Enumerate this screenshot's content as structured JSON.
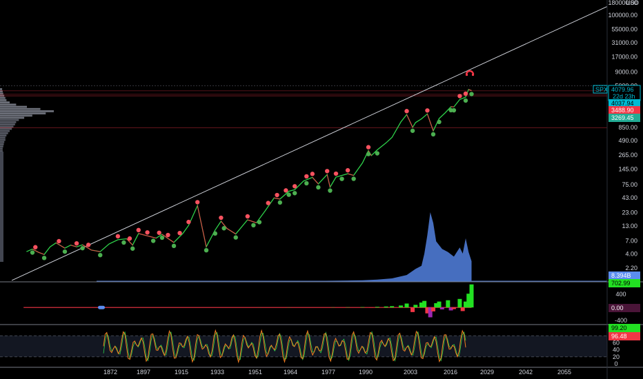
{
  "chart_data": [
    {
      "type": "line",
      "title": "",
      "symbol": "SPX",
      "currency": "USD",
      "scale": "log",
      "ylim": [
        1.5,
        180000
      ],
      "xlim": [
        1862,
        2068
      ],
      "y_ticks": [
        "180000.00",
        "100000.00",
        "55000.00",
        "31000.00",
        "17000.00",
        "9000.00",
        "5000.00",
        "2800.00",
        "1550.00",
        "850.00",
        "490.00",
        "265.00",
        "145.00",
        "75.00",
        "43.00",
        "23.00",
        "13.00",
        "7.00",
        "4.00",
        "2.20"
      ],
      "x_ticks": [
        "1872",
        "1897",
        "1915",
        "1933",
        "1951",
        "1964",
        "1977",
        "1990",
        "2003",
        "2016",
        "2029",
        "2042",
        "2055"
      ],
      "series": [
        {
          "name": "SPX",
          "color": "#2ed24a",
          "x": [
            1871,
            1873,
            1875,
            1877,
            1879,
            1881,
            1884,
            1886,
            1888,
            1890,
            1893,
            1896,
            1899,
            1902,
            1905,
            1907,
            1909,
            1912,
            1915,
            1917,
            1919,
            1921,
            1924,
            1926,
            1929,
            1932,
            1935,
            1937,
            1939,
            1942,
            1946,
            1949,
            1952,
            1955,
            1957,
            1960,
            1962,
            1965,
            1968,
            1970,
            1973,
            1974,
            1976,
            1980,
            1982,
            1985,
            1987,
            1988,
            1990,
            1993,
            1995,
            1998,
            2000,
            2002,
            2003,
            2005,
            2007,
            2009,
            2011,
            2013,
            2015,
            2016,
            2018,
            2020,
            2021,
            2022
          ],
          "y": [
            4.4,
            4.9,
            4.3,
            3.9,
            5.4,
            6.4,
            5.1,
            5.8,
            5.4,
            5.9,
            4.7,
            4.4,
            6.1,
            7.3,
            7.6,
            5.8,
            9.5,
            8.6,
            7.8,
            9.2,
            7.7,
            6.5,
            9.5,
            13.4,
            31,
            5.4,
            11,
            16,
            11.8,
            9.3,
            17,
            15,
            25,
            43,
            41,
            57,
            61,
            88,
            103,
            78,
            116,
            68,
            104,
            120,
            112,
            190,
            320,
            260,
            330,
            445,
            560,
            1080,
            1480,
            860,
            1050,
            1230,
            1520,
            740,
            1250,
            1580,
            2060,
            2050,
            2800,
            3100,
            4300,
            4079.96
          ]
        }
      ],
      "pivot_highs_x": [
        1874,
        1882,
        1888,
        1892,
        1902,
        1906,
        1909,
        1912,
        1916,
        1919,
        1923,
        1926,
        1929,
        1937,
        1946,
        1953,
        1956,
        1959,
        1962,
        1966,
        1968,
        1973,
        1976,
        1980,
        1987,
        2000,
        2007,
        2018,
        2020
      ],
      "pivot_lows_x": [
        1873,
        1877,
        1884,
        1890,
        1896,
        1904,
        1907,
        1914,
        1917,
        1921,
        1932,
        1935,
        1938,
        1942,
        1948,
        1950,
        1957,
        1960,
        1962,
        1966,
        1970,
        1974,
        1978,
        1982,
        1987,
        1990,
        2002,
        2009,
        2011,
        2015,
        2016,
        2020,
        2022
      ],
      "trendline": {
        "x": [
          1866,
          2068
        ],
        "y": [
          1.3,
          145000
        ]
      },
      "horizontal_levels": [
        4037.94,
        3488.9,
        3269.45,
        850,
        5000
      ],
      "price_tags": [
        {
          "label": "SPX",
          "value": "4079.96",
          "sub": "22d 23h",
          "color": "#00bcd4"
        },
        {
          "label": "",
          "value": "4037.94",
          "color": "#00bcd4"
        },
        {
          "label": "",
          "value": "3488.90",
          "color": "#f23645"
        },
        {
          "label": "",
          "value": "3269.45",
          "color": "#22ab94"
        }
      ],
      "volume_profile_bins": [
        0.04,
        0.05,
        0.06,
        0.08,
        0.1,
        0.12,
        0.18,
        0.3,
        0.5,
        0.75,
        1.0,
        0.85,
        0.6,
        0.45,
        0.35,
        0.3,
        0.28,
        0.25,
        0.22,
        0.18,
        0.15,
        0.12,
        0.1,
        0.1,
        0.08,
        0.07,
        0.06,
        0.05,
        0.05
      ]
    },
    {
      "type": "area",
      "title": "",
      "label": "Volume",
      "value_tag": "8.394B",
      "color": "#4a74c9",
      "x": [
        1950,
        1960,
        1970,
        1980,
        1985,
        1990,
        1995,
        2000,
        2003,
        2005,
        2006,
        2007,
        2008,
        2009,
        2010,
        2012,
        2014,
        2016,
        2018,
        2019,
        2020,
        2021,
        2022
      ],
      "values": [
        0.0,
        0.01,
        0.02,
        0.04,
        0.06,
        0.1,
        0.18,
        0.4,
        0.8,
        1.0,
        1.8,
        3.0,
        4.5,
        3.8,
        2.6,
        2.1,
        1.9,
        1.6,
        2.2,
        1.8,
        2.8,
        1.9,
        1.3
      ]
    },
    {
      "type": "bar",
      "title": "",
      "label": "Oscillator",
      "value_tags": [
        "702.99",
        "0.00"
      ],
      "y_ticks": [
        "400",
        "-400"
      ],
      "ylim": [
        -500,
        760
      ],
      "x": [
        1950,
        1960,
        1970,
        1975,
        1980,
        1985,
        1988,
        1990,
        1993,
        1995,
        1998,
        2000,
        2002,
        2003,
        2005,
        2006,
        2007,
        2008,
        2009,
        2010,
        2011,
        2012,
        2014,
        2015,
        2016,
        2018,
        2019,
        2020,
        2021,
        2022
      ],
      "values": [
        2,
        4,
        -5,
        6,
        8,
        12,
        -10,
        20,
        30,
        40,
        60,
        120,
        -140,
        80,
        150,
        200,
        -180,
        -300,
        -120,
        130,
        180,
        -60,
        220,
        -90,
        -50,
        260,
        -110,
        180,
        420,
        702.99
      ]
    },
    {
      "type": "line",
      "title": "",
      "label": "Stochastic",
      "value_tags": [
        "99.20",
        "96.48"
      ],
      "y_ticks": [
        "80",
        "60",
        "40",
        "20",
        "0"
      ],
      "ylim": [
        0,
        100
      ],
      "band": [
        20,
        80
      ],
      "k_color": "#f47f20",
      "d_color": "#2ed24a"
    }
  ]
}
